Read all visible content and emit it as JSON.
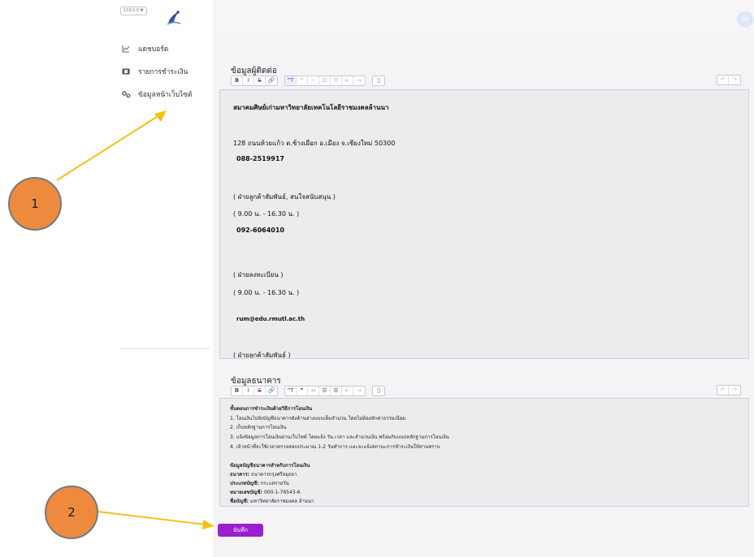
{
  "sidebar": {
    "version_badge": "119.0.0 ▼",
    "items": [
      {
        "label": "แดชบอร์ด",
        "icon": "chart-line-icon"
      },
      {
        "label": "รายการชำระเงิน",
        "icon": "payment-card-icon"
      },
      {
        "label": "ข้อมูลหน้าเว็บไซต์",
        "icon": "settings-gears-icon"
      }
    ]
  },
  "header": {
    "avatar_initials": "OE"
  },
  "contact_section": {
    "title": "ข้อมูลผู้ติดต่อ",
    "toolbar": {
      "format_group": [
        "B",
        "I",
        "S",
        "🔗"
      ],
      "block_group": [
        "ꟸT",
        "❞",
        "‹›",
        "☰",
        "☰",
        "⇤",
        "⇥"
      ],
      "media_group": [
        "▯"
      ],
      "history_group": [
        "↶",
        "↷"
      ]
    },
    "lines": [
      {
        "text": "สมาคมศิษย์เก่ามหาวิทยาลัยเทคโนโลยีราชมงคลล้านนา",
        "bold": true
      },
      {
        "text": "128 ถนนห้วยแก้ว ต.ช้างเผือก อ.เมือง จ.เชียงใหม่ 50300",
        "bold": false
      },
      {
        "text": "088-2519917",
        "bold": true
      },
      {
        "text": "( ฝ่ายลูกค้าสัมพันธ์, สนใจสนับสนุน )",
        "bold": false
      },
      {
        "text": "( 9.00 น. - 16.30 น. )",
        "bold": false
      },
      {
        "text": "092-6064010",
        "bold": true
      },
      {
        "text": "( ฝ่ายลงทะเบียน )",
        "bold": false
      },
      {
        "text": "( 9.00 น. - 16.30 น. )",
        "bold": false
      },
      {
        "text": "rum@edu.rmutl.ac.th",
        "bold": true
      },
      {
        "text": "( ฝ่ายลูกค้าสัมพันธ์ )",
        "bold": false
      }
    ]
  },
  "bank_section": {
    "title": "ข้อมูลธนาคาร",
    "lines": [
      {
        "text": "ขั้นตอนการชำระเงินด้วยวิธีการโอนเงิน",
        "bold": true
      },
      {
        "text": "1.   โอนเงินไปยังบัญชีธนาคารดังด้านล่างแบบเต็มจำนวน โดยไม่ต้องหักค่าธรรมเนียม",
        "bold": false
      },
      {
        "text": "2.   เก็บหลักฐานการโอนเงิน",
        "bold": false
      },
      {
        "text": "3.   แจ้งข้อมูลการโอนเงินผ่านเว็บไซต์ โดยแจ้ง วัน เวลา และจำนวนเงิน พร้อมกับแนบหลักฐานการโอนเงิน",
        "bold": false
      },
      {
        "text": "4.   เจ้าหน้าที่จะใช้เวลาตรวจสอบประมาณ 1-2 วันทำการ และจะแจ้งสถานะการชำระเงินให้ท่านทราบ",
        "bold": false
      },
      {
        "text": "ข้อมูลบัญชีธนาคารสำหรับการโอนเงิน",
        "bold": true
      },
      {
        "label": "ธนาคาร:",
        "value": " ธนาคารกรุงศรีอยุธยา"
      },
      {
        "label": "ประเภทบัญชี:",
        "value": " กระแสรายวัน"
      },
      {
        "label": "หมายเลขบัญชี:",
        "value": " 000-1-76543-6"
      },
      {
        "label": "ชื่อบัญชี:",
        "value": " มหาวิทยาลัยราชมงคล ล้านนา"
      }
    ]
  },
  "save_label": "บันทึก",
  "annotations": {
    "one": "1",
    "two": "2"
  }
}
